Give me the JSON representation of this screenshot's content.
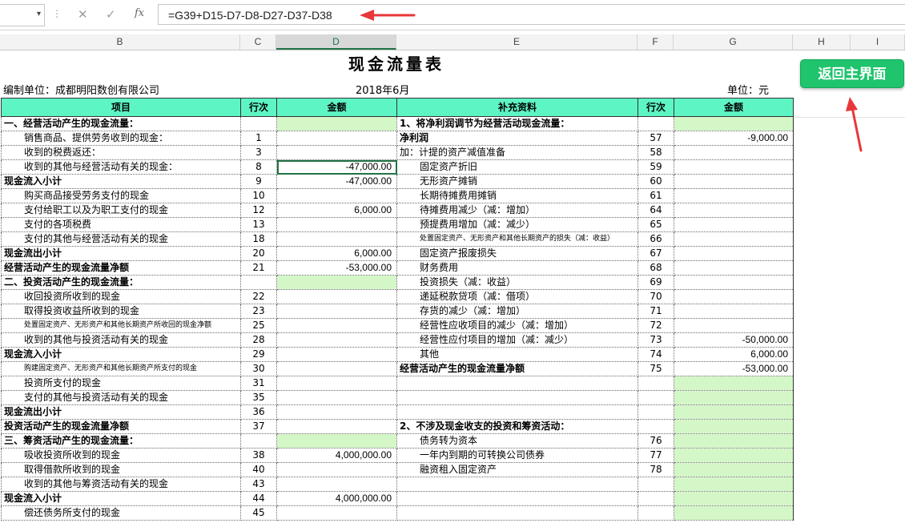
{
  "formula_bar": {
    "name_box": "",
    "formula": "=G39+D15-D7-D8-D27-D37-D38",
    "cancel_glyph": "✕",
    "enter_glyph": "✓",
    "fx_glyph": "fx"
  },
  "columns": [
    "B",
    "C",
    "D",
    "E",
    "F",
    "G",
    "H",
    "I"
  ],
  "sheet": {
    "title": "现金流量表",
    "company": "编制单位：成都明阳数创有限公司",
    "period": "2018年6月",
    "unit": "单位：元",
    "return_button": "返回主界面"
  },
  "table": {
    "headers": [
      "项目",
      "行次",
      "金额",
      "补充资料",
      "行次",
      "金额"
    ],
    "rows": [
      [
        "一、经营活动产生的现金流量：",
        "",
        "",
        "1、将净利润调节为经营活动现金流量：",
        "",
        ""
      ],
      [
        "销售商品、提供劳务收到的现金：",
        "1",
        "",
        "净利润",
        "57",
        "-9,000.00"
      ],
      [
        "收到的税费返还：",
        "3",
        "",
        "加：计提的资产减值准备",
        "58",
        ""
      ],
      [
        "收到的其他与经营活动有关的现金：",
        "8",
        "-47,000.00",
        "固定资产折旧",
        "59",
        ""
      ],
      [
        "现金流入小计",
        "9",
        "-47,000.00",
        "无形资产摊销",
        "60",
        ""
      ],
      [
        "购买商品接受劳务支付的现金",
        "10",
        "",
        "长期待摊费用摊销",
        "61",
        ""
      ],
      [
        "支付给职工以及为职工支付的现金",
        "12",
        "6,000.00",
        "待摊费用减少（减：增加）",
        "64",
        ""
      ],
      [
        "支付的各项税费",
        "13",
        "",
        "预提费用增加（减：减少）",
        "65",
        ""
      ],
      [
        "支付的其他与经营活动有关的现金",
        "18",
        "",
        "处置固定资产、无形资产和其他长期资产的损失（减：收益）",
        "66",
        ""
      ],
      [
        "现金流出小计",
        "20",
        "6,000.00",
        "固定资产报废损失",
        "67",
        ""
      ],
      [
        "经营活动产生的现金流量净额",
        "21",
        "-53,000.00",
        "财务费用",
        "68",
        ""
      ],
      [
        "二、投资活动产生的现金流量：",
        "",
        "",
        "投资损失（减：收益）",
        "69",
        ""
      ],
      [
        "收回投资所收到的现金",
        "22",
        "",
        "递延税款贷项（减：借项）",
        "70",
        ""
      ],
      [
        "取得投资收益所收到的现金",
        "23",
        "",
        "存货的减少（减：增加）",
        "71",
        ""
      ],
      [
        "处置固定资产、无形资产和其他长期资产所收回的现金净额",
        "25",
        "",
        "经营性应收项目的减少（减：增加）",
        "72",
        ""
      ],
      [
        "收到的其他与投资活动有关的现金",
        "28",
        "",
        "经营性应付项目的增加（减：减少）",
        "73",
        "-50,000.00"
      ],
      [
        "现金流入小计",
        "29",
        "",
        "其他",
        "74",
        "6,000.00"
      ],
      [
        "购建固定资产、无形资产和其他长期资产所支付的现金",
        "30",
        "",
        "经营活动产生的现金流量净额",
        "75",
        "-53,000.00"
      ],
      [
        "投资所支付的现金",
        "31",
        "",
        "",
        "",
        ""
      ],
      [
        "支付的其他与投资活动有关的现金",
        "35",
        "",
        "",
        "",
        ""
      ],
      [
        "现金流出小计",
        "36",
        "",
        "",
        "",
        ""
      ],
      [
        "投资活动产生的现金流量净额",
        "37",
        "",
        "2、不涉及现金收支的投资和筹资活动：",
        "",
        ""
      ],
      [
        "三、筹资活动产生的现金流量：",
        "",
        "",
        "债务转为资本",
        "76",
        ""
      ],
      [
        "吸收投资所收到的现金",
        "38",
        "4,000,000.00",
        "一年内到期的可转换公司债券",
        "77",
        ""
      ],
      [
        "取得借款所收到的现金",
        "40",
        "",
        "融资租入固定资产",
        "78",
        ""
      ],
      [
        "收到的其他与筹资活动有关的现金",
        "43",
        "",
        "",
        "",
        ""
      ],
      [
        "现金流入小计",
        "44",
        "4,000,000.00",
        "",
        "",
        ""
      ],
      [
        "偿还债务所支付的现金",
        "45",
        "",
        "",
        "",
        ""
      ]
    ]
  }
}
